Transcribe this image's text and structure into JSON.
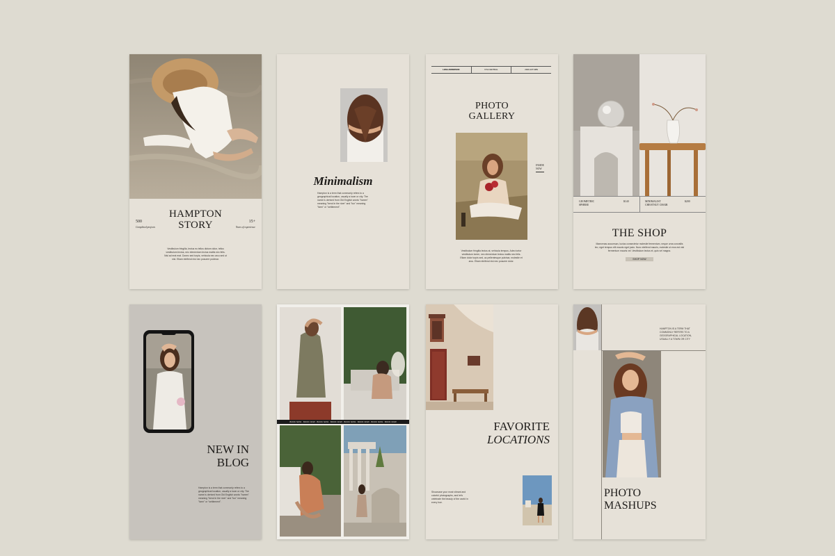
{
  "colors": {
    "background": "#dedbd1",
    "card": "#e6e1d8",
    "card_gray": "#c7c3bd",
    "ink": "#1d1b19"
  },
  "cards": {
    "hampton": {
      "title_line1": "HAMPTON",
      "title_line2": "STORY",
      "stat_left_num": "500",
      "stat_left_label": "Completed projects",
      "stat_right_num": "15+",
      "stat_right_label": "Years of experience",
      "body": "Vestibulum fringilla, lectus eu tellus dictum dolor, tellus vestibulum lectus, nec elementum lectus mattis nec felis. Nisl ad erat erat. Donec sed turpis, vehicula nec arcu sed ut nisl. Etiam eleifend nisi nec posuere pulvinar."
    },
    "minimalism": {
      "title": "Minimalism",
      "body": "Hampton is a term that commonly refers to a geographical location, usually a town or city. The name is derived from Old English words \"hamm\" meaning \"bend in the river\" and \"tun\" meaning \"farm\" or \"settlement\"."
    },
    "gallery": {
      "header_cells": [
        "LENA ANDERSON",
        "NYA CENTRAL",
        "2024 AUTUMN"
      ],
      "title_line1": "PHOTO",
      "title_line2": "GALLERY",
      "side_label_line1": "INSIDE",
      "side_label_line2": "NOW",
      "body": "Vestibulum fringilla lectus at, vehicula tempus. Adeo tortor vestibulum lorem, nec elementum lectus mattis nec felis. Etiam dolor turpis sed, ac pellentesque pulvinar, molestie et arcu. Etiam eleifend nisi nec posuere dolor."
    },
    "shop": {
      "item1_name_line1": "GEOMETRIC",
      "item1_name_line2": "SPHERE",
      "item1_price": "$140",
      "item2_name_line1": "MINIMALIST",
      "item2_name_line2": "CHESTNUT CHAIR",
      "item2_price": "$200",
      "title": "THE SHOP",
      "body": "Maecenas accumsan, luctus consectetur molestie fermentum, neque urna convallis leo, eget tempus elit mauris eget justo. Nunc eleifend mauris, molestie ut eros est nisl fermentum mauris vel. Vestibulum lectus et, quis vel magna.",
      "button": "SHOP NOW"
    },
    "blog": {
      "title_line1": "NEW IN",
      "title_line2": "BLOG",
      "body": "Hampton is a term that commonly refers to a geographical location, usually a town or city. The name is derived from Old English words \"hamm\" meaning \"bend in the river\" and \"tun\" meaning \"farm\" or \"settlement\"."
    },
    "collage": {
      "strip_text": "BOOK NOW · BOOK NOW · BOOK NOW · BOOK NOW · BOOK NOW · BOOK NOW · BOOK NOW · BOOK NOW"
    },
    "locations": {
      "title_line1": "FAVORITE",
      "title_line2": "LOCATIONS",
      "body": "Showcase your most vibrant and colorful photographs, and let's celebrate the beauty of the world in every hue."
    },
    "mashups": {
      "caption": "HAMPTON IS A TERM THAT COMMONLY REFERS TO A GEOGRAPHICAL LOCATION, USUALLY A TOWN OR CITY",
      "title_line1": "PHOTO",
      "title_line2": "MASHUPS"
    }
  }
}
